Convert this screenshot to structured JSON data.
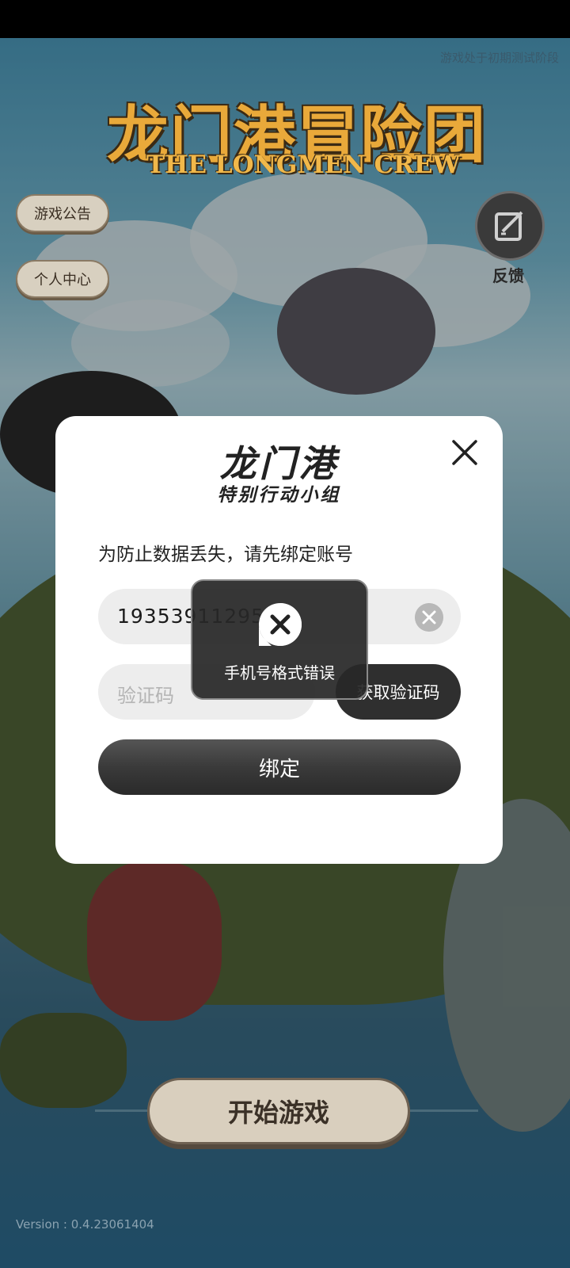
{
  "game": {
    "notice": "游戏处于初期测试阶段",
    "logo_cn": "龙门港冒险团",
    "logo_en": "THE LONGMEN CREW"
  },
  "side_buttons": {
    "announcement": "游戏公告",
    "profile": "个人中心"
  },
  "feedback": {
    "label": "反馈"
  },
  "start_button": "开始游戏",
  "version": "Version : 0.4.23061404",
  "dialog": {
    "logo_line1": "龙门港",
    "logo_line2": "特别行动小组",
    "description": "为防止数据丢失，请先绑定账号",
    "phone_value": "19353911295",
    "code_placeholder": "验证码",
    "get_code_label": "获取验证码",
    "bind_label": "绑定"
  },
  "toast": {
    "message": "手机号格式错误"
  }
}
